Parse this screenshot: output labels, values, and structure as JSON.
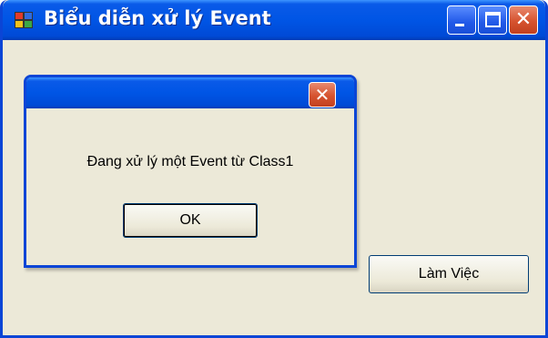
{
  "window": {
    "title": "Biểu diễn xử lý Event",
    "close_glyph": "✕"
  },
  "main": {
    "button_label": "Làm Việc"
  },
  "dialog": {
    "message": "Đang xử lý một Event từ Class1",
    "ok_label": "OK",
    "close_glyph": "✕"
  },
  "icons": {
    "app": "app-window-icon",
    "minimize": "minimize-icon",
    "maximize": "maximize-icon",
    "close": "close-icon"
  },
  "colors": {
    "titlebar_blue": "#0055e5",
    "window_face": "#ece9d8",
    "close_red": "#d6532f"
  }
}
